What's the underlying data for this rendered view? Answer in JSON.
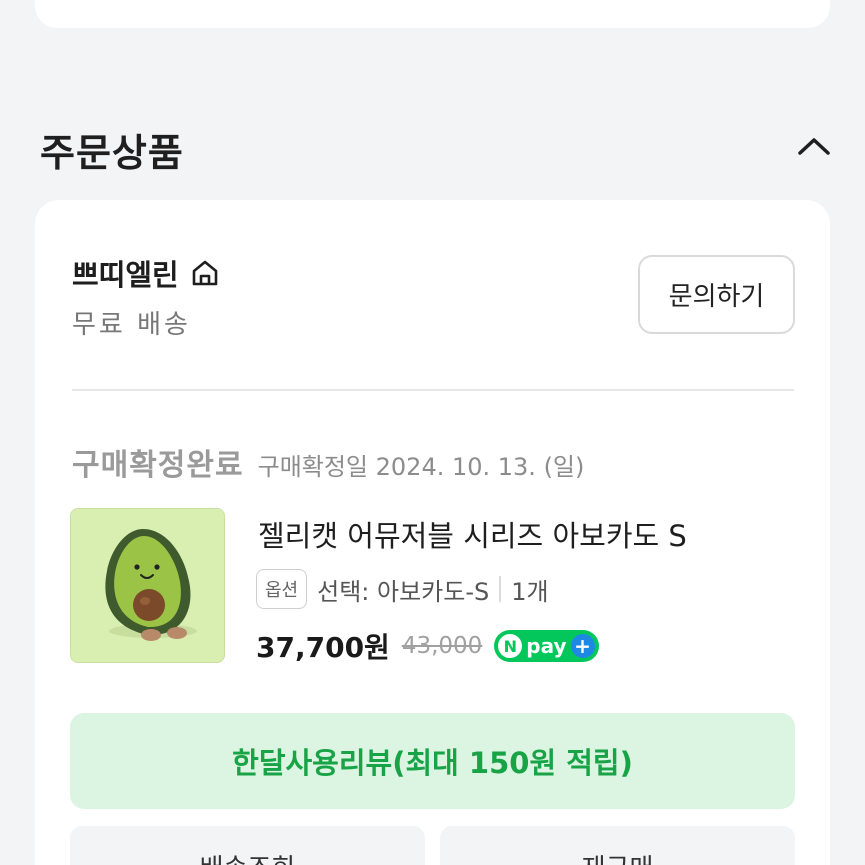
{
  "section": {
    "title": "주문상품"
  },
  "shop": {
    "name": "쁘띠엘린",
    "shipping": "무료 배송",
    "inquiry_label": "문의하기"
  },
  "order": {
    "status": "구매확정완료",
    "confirm_date": "구매확정일 2024. 10. 13. (일)"
  },
  "product": {
    "name": "젤리캣 어뮤저블 시리즈 아보카도 S",
    "option_badge": "옵션",
    "option_text": "선택: 아보카도-S",
    "quantity": "1개",
    "price": "37,700원",
    "original_price": "43,000",
    "npay_n": "N",
    "npay_label": "pay",
    "npay_plus": "+"
  },
  "actions": {
    "review_label": "한달사용리뷰(최대 150원 적립)",
    "bottom_left_label": "배송조회",
    "bottom_right_label": "재구매"
  },
  "colors": {
    "accent_green": "#17a346",
    "review_bg": "#dcf5e2",
    "npay_green": "#03c75a",
    "background": "#f3f4f6"
  }
}
